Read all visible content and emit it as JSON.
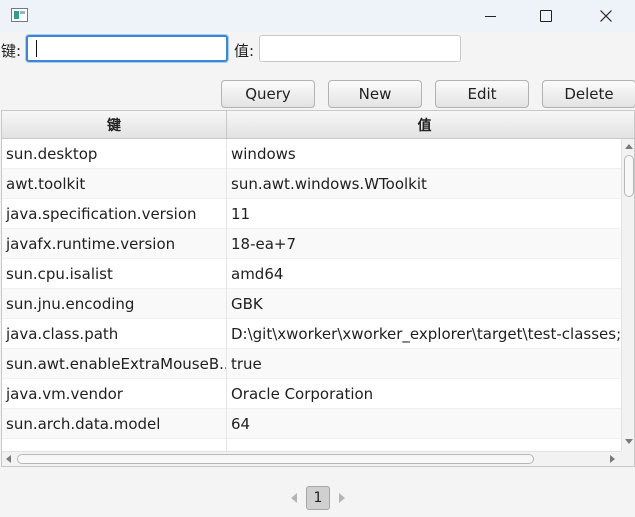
{
  "window": {
    "icon": "app-window-icon",
    "controls": [
      "minimize-icon",
      "maximize-icon",
      "close-icon"
    ]
  },
  "form": {
    "key_label": "键:",
    "key_value": "",
    "value_label": "值:",
    "value_value": ""
  },
  "toolbar": {
    "query_label": "Query",
    "new_label": "New",
    "edit_label": "Edit",
    "delete_label": "Delete"
  },
  "table": {
    "columns": [
      "键",
      "值"
    ],
    "rows": [
      {
        "key": "sun.desktop",
        "value": "windows"
      },
      {
        "key": "awt.toolkit",
        "value": "sun.awt.windows.WToolkit"
      },
      {
        "key": "java.specification.version",
        "value": "11"
      },
      {
        "key": "javafx.runtime.version",
        "value": "18-ea+7"
      },
      {
        "key": "sun.cpu.isalist",
        "value": "amd64"
      },
      {
        "key": "sun.jnu.encoding",
        "value": "GBK"
      },
      {
        "key": "java.class.path",
        "value": "D:\\git\\xworker\\xworker_explorer\\target\\test-classes;D"
      },
      {
        "key": "sun.awt.enableExtraMouseB...",
        "value": "true"
      },
      {
        "key": "java.vm.vendor",
        "value": "Oracle Corporation"
      },
      {
        "key": "sun.arch.data.model",
        "value": "64"
      },
      {
        "key": "",
        "value": ""
      }
    ]
  },
  "pagination": {
    "current_page": "1"
  },
  "colors": {
    "focus_accent": "#3b86d6",
    "titlebar": "#eef3f9"
  }
}
